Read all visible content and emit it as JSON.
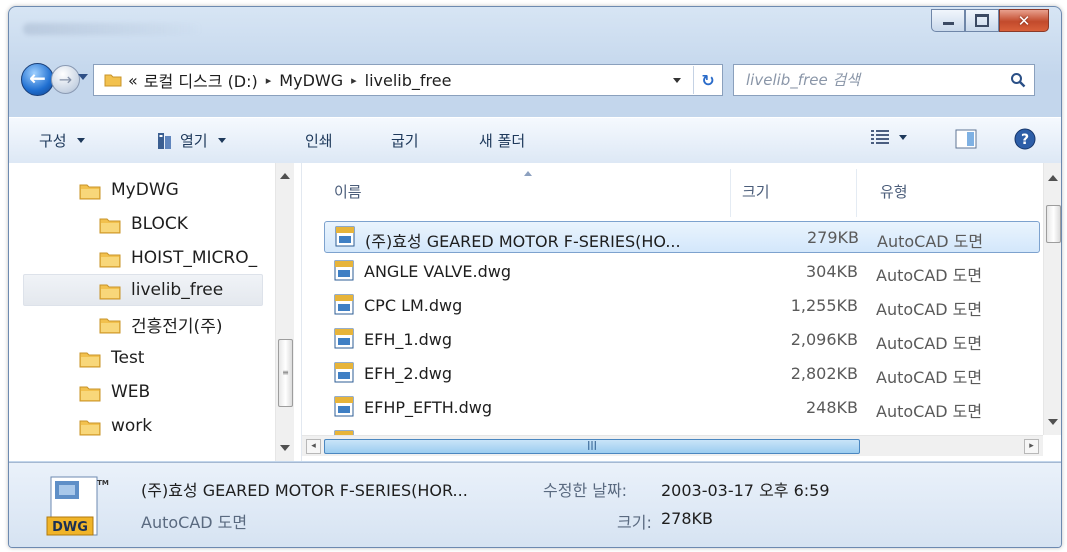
{
  "window": {
    "controls": {
      "minimize_icon": "minimize-icon",
      "maximize_icon": "maximize-icon",
      "close_icon": "close-icon"
    }
  },
  "address_bar": {
    "overflow": "«",
    "segments": [
      "로컬 디스크 (D:)",
      "MyDWG",
      "livelib_free"
    ],
    "separator": "▸"
  },
  "search": {
    "placeholder": "livelib_free 검색"
  },
  "toolbar": {
    "organize": "구성",
    "open": "열기",
    "print": "인쇄",
    "burn": "굽기",
    "new_folder": "새 폴더"
  },
  "nav_tree": [
    {
      "label": "MyDWG"
    },
    {
      "label": "BLOCK"
    },
    {
      "label": "HOIST_MICRO_"
    },
    {
      "label": "livelib_free",
      "selected": true
    },
    {
      "label": "건흥전기(주)"
    },
    {
      "label": "Test"
    },
    {
      "label": "WEB"
    },
    {
      "label": "work"
    }
  ],
  "columns": {
    "name": "이름",
    "size": "크기",
    "type": "유형"
  },
  "files": [
    {
      "name": "(주)효성 GEARED MOTOR F-SERIES(HO...",
      "size": "279KB",
      "type": "AutoCAD 도면",
      "selected": true
    },
    {
      "name": "ANGLE VALVE.dwg",
      "size": "304KB",
      "type": "AutoCAD 도면"
    },
    {
      "name": "CPC LM.dwg",
      "size": "1,255KB",
      "type": "AutoCAD 도면"
    },
    {
      "name": "EFH_1.dwg",
      "size": "2,096KB",
      "type": "AutoCAD 도면"
    },
    {
      "name": "EFH_2.dwg",
      "size": "2,802KB",
      "type": "AutoCAD 도면"
    },
    {
      "name": "EFHP_EFTH.dwg",
      "size": "248KB",
      "type": "AutoCAD 도면"
    }
  ],
  "details": {
    "filename": "(주)효성 GEARED MOTOR F-SERIES(HOR...",
    "filetype": "AutoCAD 도면",
    "modified_label": "수정한 날짜:",
    "modified_value": "2003-03-17 오후 6:59",
    "size_label": "크기:",
    "size_value": "278KB",
    "icon_label": "DWG",
    "icon_tm": "TM"
  },
  "colors": {
    "selection": "#d3e7fb",
    "folder": "#f2c14e",
    "accent": "#2a6bc9"
  }
}
